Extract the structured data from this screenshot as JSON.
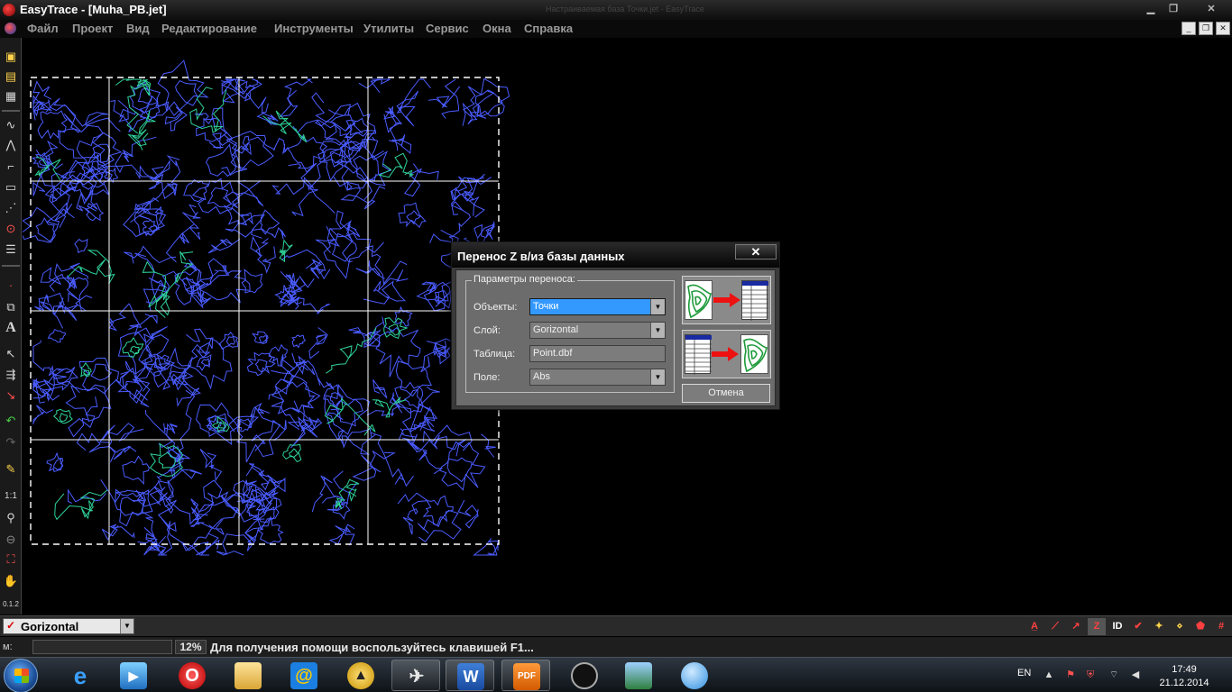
{
  "window": {
    "title": "EasyTrace - [Muha_PB.jet]",
    "ghost_title": "Настраиваемая база Точки.jet - EasyTrace"
  },
  "menu": [
    "Файл",
    "Проект",
    "Вид",
    "Редактирование",
    "Инструменты",
    "Утилиты",
    "Сервис",
    "Окна",
    "Справка"
  ],
  "dialog": {
    "title": "Перенос Z в/из базы данных",
    "close_label": "✕",
    "group_label": "Параметры переноса:",
    "objects_label": "Объекты:",
    "objects_value": "Точки",
    "layer_label": "Слой:",
    "layer_value": "Gorizontal",
    "table_label": "Таблица:",
    "table_value": "Point.dbf",
    "field_label": "Поле:",
    "field_value": "Abs",
    "cancel_label": "Отмена"
  },
  "layerbar": {
    "current_layer": "Gorizontal"
  },
  "status": {
    "m_label": "м:",
    "zoom": "12%",
    "hint": "Для получения помощи воспользуйтесь клавишей F1..."
  },
  "toolbar": {
    "scale_label": "1:1"
  },
  "tray": {
    "language": "EN",
    "time": "17:49",
    "date": "21.12.2014"
  },
  "colors": {
    "contour_blue": "#4a5cff",
    "contour_green": "#2fd39a",
    "grid_white": "#ffffff",
    "dialog_body": "#6c6c6c",
    "selection": "#3399ff"
  }
}
